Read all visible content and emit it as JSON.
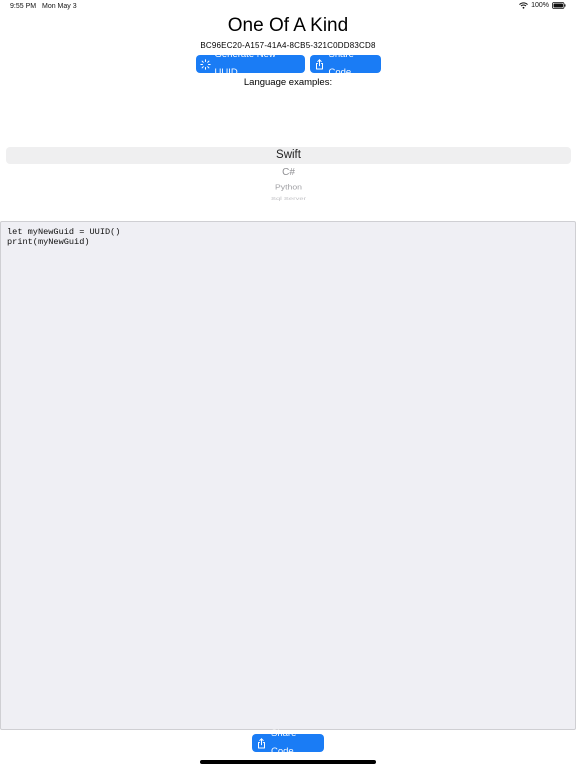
{
  "status_bar": {
    "time": "9:55 PM",
    "date": "Mon May 3",
    "battery_percent": "100%",
    "battery_level": 1.0,
    "icons": [
      "wifi-icon",
      "battery-icon"
    ]
  },
  "header": {
    "title": "One Of A Kind",
    "uuid": "BC96EC20-A157-41A4-8CB5-321C0DD83CD8"
  },
  "toolbar": {
    "generate_label": "Generate New UUID",
    "generate_icon": "sparkle-icon",
    "share_label": "Share Code",
    "share_icon": "share-icon"
  },
  "languages": {
    "label": "Language examples:",
    "selected": "Swift",
    "items": [
      "Swift",
      "C#",
      "Python",
      "Sql Server"
    ]
  },
  "code": {
    "text": "let myNewGuid = UUID()\nprint(myNewGuid)"
  },
  "bottom_bar": {
    "share_label": "Share Code",
    "share_icon": "share-icon"
  },
  "colors": {
    "accent": "#1a7cf5",
    "code_background": "#efeff4",
    "picker_selection": "#efeff0"
  }
}
